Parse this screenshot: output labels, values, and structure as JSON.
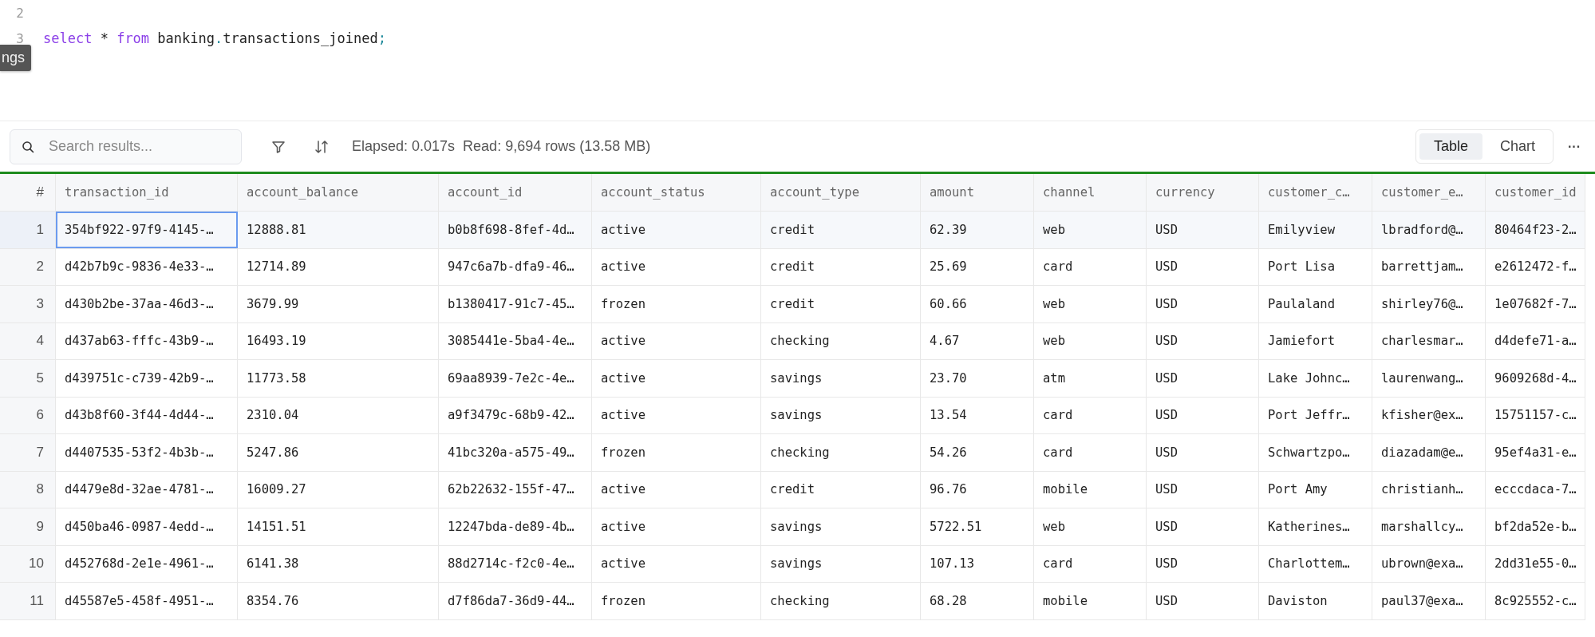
{
  "editor": {
    "lines": [
      {
        "number": "2"
      },
      {
        "number": "3",
        "tokens": [
          {
            "kind": "keyword",
            "text": "select"
          },
          {
            "kind": "plain",
            "text": " * "
          },
          {
            "kind": "keyword",
            "text": "from"
          },
          {
            "kind": "plain",
            "text": " banking"
          },
          {
            "kind": "punct",
            "text": "."
          },
          {
            "kind": "plain",
            "text": "transactions_joined"
          },
          {
            "kind": "punct",
            "text": ";"
          }
        ]
      }
    ],
    "tooltip": "ngs"
  },
  "toolbar": {
    "search": {
      "placeholder": "Search results..."
    },
    "status": "Elapsed: 0.017s  Read: 9,694 rows (13.58 MB)",
    "view_tabs": [
      {
        "label": "Table",
        "selected": true
      },
      {
        "label": "Chart",
        "selected": false
      }
    ],
    "more": "···"
  },
  "table": {
    "columns": [
      "#",
      "transaction_id",
      "account_balance",
      "account_id",
      "account_status",
      "account_type",
      "amount",
      "channel",
      "currency",
      "customer_c…",
      "customer_e…",
      "customer_id"
    ],
    "rows": [
      {
        "selected": true,
        "cells": [
          "1",
          "354bf922-97f9-4145-…",
          "12888.81",
          "b0b8f698-8fef-4d…",
          "active",
          "credit",
          "62.39",
          "web",
          "USD",
          "Emilyview",
          "lbradford@…",
          "80464f23-2…"
        ]
      },
      {
        "selected": false,
        "cells": [
          "2",
          "d42b7b9c-9836-4e33-…",
          "12714.89",
          "947c6a7b-dfa9-46…",
          "active",
          "credit",
          "25.69",
          "card",
          "USD",
          "Port Lisa",
          "barrettjam…",
          "e2612472-f…"
        ]
      },
      {
        "selected": false,
        "cells": [
          "3",
          "d430b2be-37aa-46d3-…",
          "3679.99",
          "b1380417-91c7-45…",
          "frozen",
          "credit",
          "60.66",
          "web",
          "USD",
          "Paulaland",
          "shirley76@…",
          "1e07682f-7…"
        ]
      },
      {
        "selected": false,
        "cells": [
          "4",
          "d437ab63-fffc-43b9-…",
          "16493.19",
          "3085441e-5ba4-4e…",
          "active",
          "checking",
          "4.67",
          "web",
          "USD",
          "Jamiefort",
          "charlesmar…",
          "d4defe71-a…"
        ]
      },
      {
        "selected": false,
        "cells": [
          "5",
          "d439751c-c739-42b9-…",
          "11773.58",
          "69aa8939-7e2c-4e…",
          "active",
          "savings",
          "23.70",
          "atm",
          "USD",
          "Lake Johnc…",
          "laurenwang…",
          "9609268d-4…"
        ]
      },
      {
        "selected": false,
        "cells": [
          "6",
          "d43b8f60-3f44-4d44-…",
          "2310.04",
          "a9f3479c-68b9-42…",
          "active",
          "savings",
          "13.54",
          "card",
          "USD",
          "Port Jeffr…",
          "kfisher@ex…",
          "15751157-c…"
        ]
      },
      {
        "selected": false,
        "cells": [
          "7",
          "d4407535-53f2-4b3b-…",
          "5247.86",
          "41bc320a-a575-49…",
          "frozen",
          "checking",
          "54.26",
          "card",
          "USD",
          "Schwartzpo…",
          "diazadam@e…",
          "95ef4a31-e…"
        ]
      },
      {
        "selected": false,
        "cells": [
          "8",
          "d4479e8d-32ae-4781-…",
          "16009.27",
          "62b22632-155f-47…",
          "active",
          "credit",
          "96.76",
          "mobile",
          "USD",
          "Port Amy",
          "christianh…",
          "ecccdaca-7…"
        ]
      },
      {
        "selected": false,
        "cells": [
          "9",
          "d450ba46-0987-4edd-…",
          "14151.51",
          "12247bda-de89-4b…",
          "active",
          "savings",
          "5722.51",
          "web",
          "USD",
          "Katherines…",
          "marshallcy…",
          "bf2da52e-b…"
        ]
      },
      {
        "selected": false,
        "cells": [
          "10",
          "d452768d-2e1e-4961-…",
          "6141.38",
          "88d2714c-f2c0-4e…",
          "active",
          "savings",
          "107.13",
          "card",
          "USD",
          "Charlottem…",
          "ubrown@exa…",
          "2dd31e55-0…"
        ]
      },
      {
        "selected": false,
        "cells": [
          "11",
          "d45587e5-458f-4951-…",
          "8354.76",
          "d7f86da7-36d9-44…",
          "frozen",
          "checking",
          "68.28",
          "mobile",
          "USD",
          "Daviston",
          "paul37@exa…",
          "8c925552-c…"
        ]
      }
    ]
  }
}
